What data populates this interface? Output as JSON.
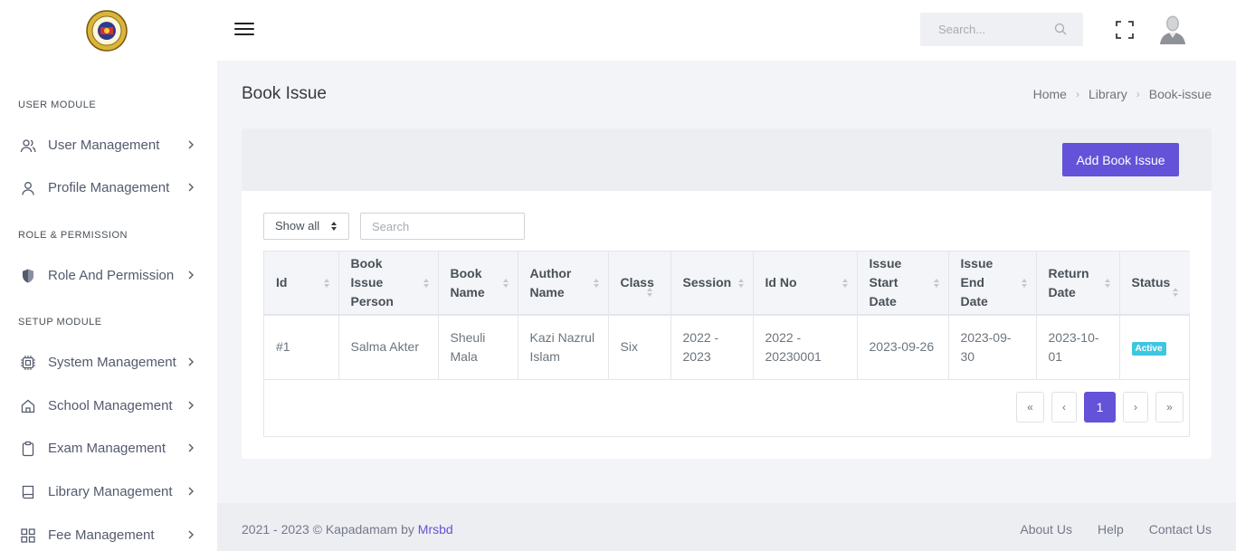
{
  "header": {
    "search_placeholder": "Search..."
  },
  "sidebar": {
    "sections": [
      {
        "title": "USER MODULE"
      },
      {
        "title": "ROLE & PERMISSION"
      },
      {
        "title": "SETUP MODULE"
      }
    ],
    "items": [
      {
        "label": "User Management",
        "icon": "users-icon"
      },
      {
        "label": "Profile Management",
        "icon": "user-icon"
      },
      {
        "label": "Role And Permission",
        "icon": "shield-icon"
      },
      {
        "label": "System Management",
        "icon": "chip-icon"
      },
      {
        "label": "School Management",
        "icon": "home-icon"
      },
      {
        "label": "Exam Management",
        "icon": "clipboard-icon"
      },
      {
        "label": "Library Management",
        "icon": "book-icon"
      },
      {
        "label": "Fee Management",
        "icon": "grid-icon"
      }
    ]
  },
  "page": {
    "title": "Book Issue",
    "breadcrumb": [
      "Home",
      "Library",
      "Book-issue"
    ]
  },
  "card": {
    "add_button": "Add Book Issue",
    "show_select": "Show all",
    "search_placeholder": "Search"
  },
  "table": {
    "columns": [
      "Id",
      "Book Issue Person",
      "Book Name",
      "Author Name",
      "Class",
      "Session",
      "Id No",
      "Issue Start Date",
      "Issue End Date",
      "Return Date",
      "Status"
    ],
    "rows": [
      {
        "id": "#1",
        "person": "Salma Akter",
        "book": "Sheuli Mala",
        "author": "Kazi Nazrul Islam",
        "class": "Six",
        "session": "2022 - 2023",
        "id_no": "2022 - 20230001",
        "start": "2023-09-26",
        "end": "2023-09-30",
        "return": "2023-10-01",
        "status": "Active"
      }
    ]
  },
  "pagination": {
    "first": "«",
    "prev": "‹",
    "current": "1",
    "next": "›",
    "last": "»"
  },
  "footer": {
    "copyright": "2021 - 2023 © Kapadamam by ",
    "brand": "Mrsbd",
    "links": [
      "About Us",
      "Help",
      "Contact Us"
    ]
  },
  "colors": {
    "accent": "#6452d8",
    "badge": "#3ec6e0"
  }
}
